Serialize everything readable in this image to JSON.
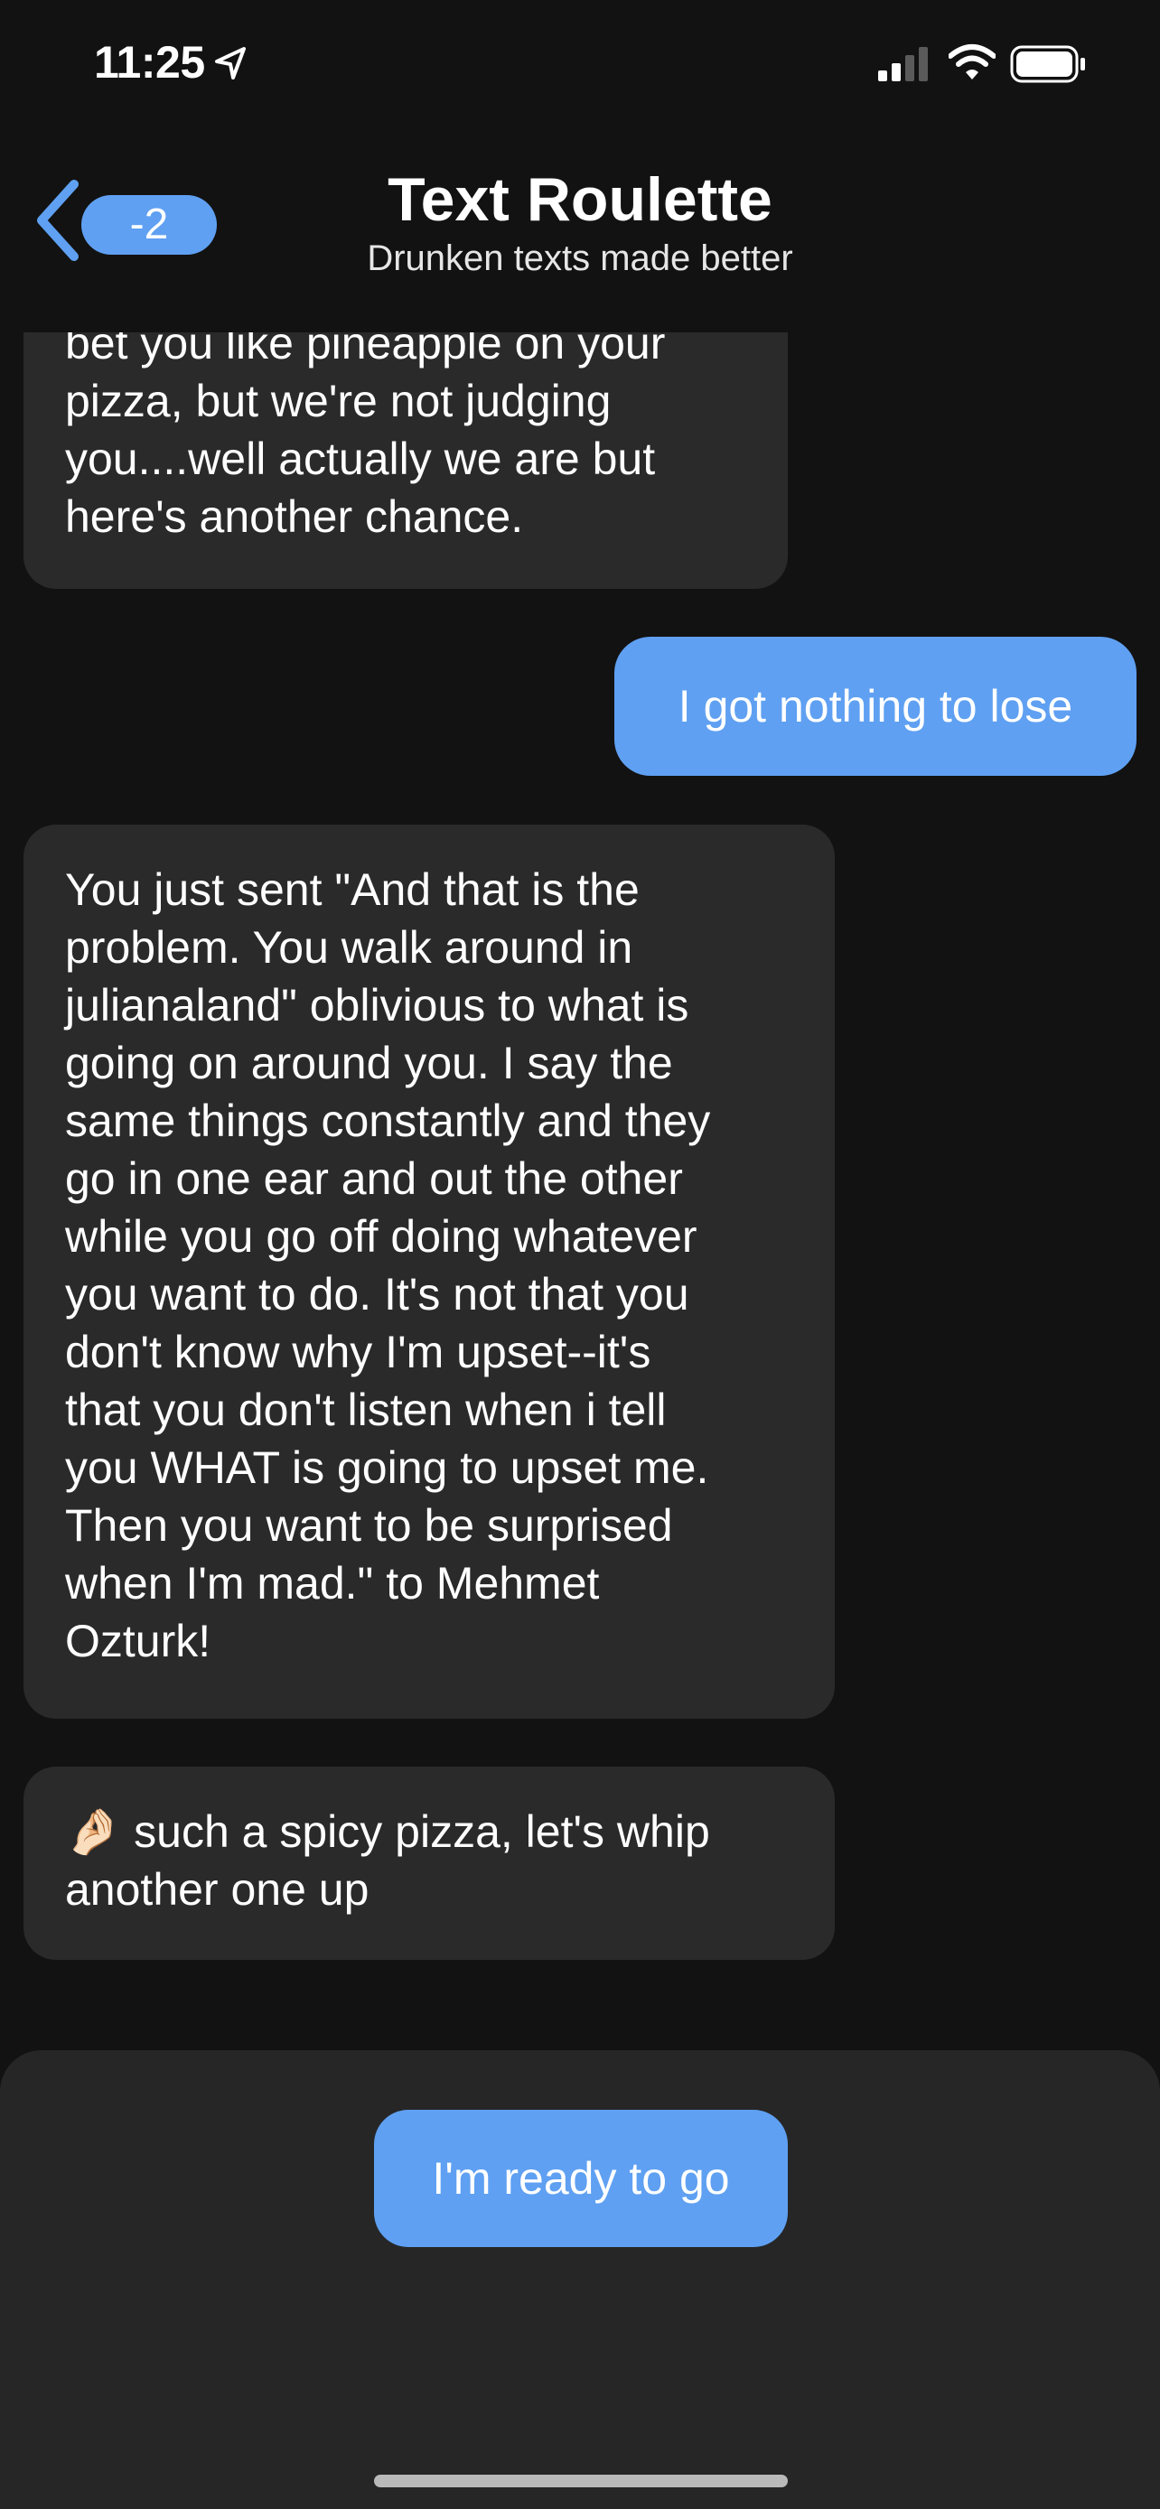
{
  "status_bar": {
    "time": "11:25",
    "icons": [
      "location-arrow-icon",
      "cellular-signal-icon",
      "wifi-icon",
      "battery-icon"
    ]
  },
  "nav": {
    "back_badge": "-2",
    "title": "Text Roulette",
    "subtitle": "Drunken texts made better",
    "accent_color": "#5fa0f2"
  },
  "messages": [
    {
      "direction": "incoming",
      "lines": [
        "bet you like pineapple on your",
        "pizza, but we're not judging",
        "you....well actually we are but",
        "here's another chance."
      ]
    },
    {
      "direction": "outgoing",
      "lines": [
        "I got nothing to lose"
      ]
    },
    {
      "direction": "incoming",
      "lines": [
        "You just sent \"And that is the",
        "problem. You walk around in",
        "julianaland\" oblivious to what is",
        "going on around you. I say the",
        "same things constantly and they",
        "go in one ear and out the other",
        "while you go off doing whatever",
        "you want to do. It's not that you",
        "don't know why I'm upset--it's",
        "that you don't listen when i tell",
        "you WHAT is going to upset me.",
        "Then you want to be surprised",
        "when I'm mad.\" to Mehmet",
        "Ozturk!"
      ]
    },
    {
      "direction": "incoming",
      "lines": [
        "🤌🏻 such a spicy pizza, let's whip",
        "another one up"
      ]
    }
  ],
  "bottom": {
    "ready_button_label": "I'm ready to go"
  },
  "colors": {
    "background": "#121212",
    "incoming_bubble": "#2a2a2b",
    "outgoing_bubble": "#5fa0f2",
    "bottom_panel": "#262627"
  }
}
